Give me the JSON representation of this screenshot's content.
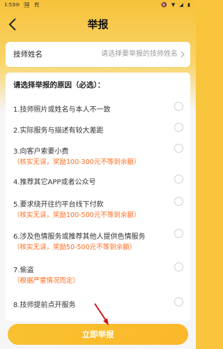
{
  "status": {
    "time": "1:53",
    "mid": "✉ 🖼 兜",
    "right": "🔇 ▼ ◢ ▮"
  },
  "header": {
    "title": "举报",
    "back_icon": "chevron-left-icon"
  },
  "technician": {
    "label": "技师姓名",
    "placeholder": "请选择要举报的技师姓名"
  },
  "reasons": {
    "title": "请选择举报的原因（必选）：",
    "items": [
      {
        "text": "1.技师照片或姓名与本人不一致",
        "note": ""
      },
      {
        "text": "2.实际服务与描述有较大差距",
        "note": ""
      },
      {
        "text": "3.向客户索要小费",
        "note": "（核实无误，奖励100-300元不等到余额）"
      },
      {
        "text": "4.推荐其它APP或者公众号",
        "note": ""
      },
      {
        "text": "5.要求绕开往约平台线下付款",
        "note": "（核实无误，奖励100-500元不等到余额）"
      },
      {
        "text": "6.涉及色情服务或推荐其他人提供色情服务",
        "note": "（核实无误，奖励50-500元不等到余额）"
      },
      {
        "text": "7.偷盗",
        "note": "（根据严重情况而定）"
      },
      {
        "text": "8.技师提前点开服务",
        "note": ""
      }
    ]
  },
  "submit": {
    "label": "立即举报"
  },
  "colors": {
    "accent": "#f8c53d",
    "note": "#ff6a1a"
  }
}
